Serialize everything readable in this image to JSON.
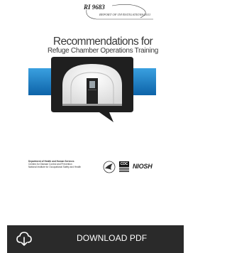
{
  "cover": {
    "report_number": "RI 9683",
    "report_series": "REPORT OF INVESTIGATIONS/2011",
    "title_line1": "Recommendations for",
    "title_line2": "Refuge Chamber Operations Training",
    "agency_line1": "Department of Health and Human Services",
    "agency_line2": "Centers for Disease Control and Prevention",
    "agency_line3": "National Institute for Occupational Safety and Health",
    "cdc_logo_text": "CDC",
    "niosh_logo_text": "NIOSH",
    "hero_icon": "refuge-chamber-speech-bubble-icon",
    "colors": {
      "band_blue": "#1e7fc4",
      "bubble_dark": "#1f1f1f"
    }
  },
  "download": {
    "label": "DOWNLOAD PDF",
    "icon": "cloud-download-icon",
    "background": "#2a2a2a"
  }
}
